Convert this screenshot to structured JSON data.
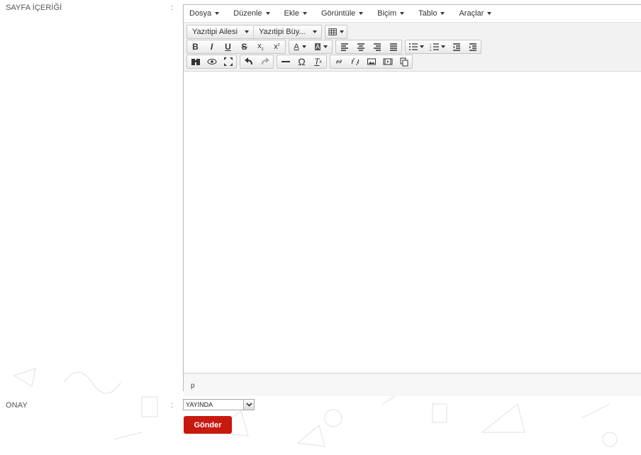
{
  "form": {
    "content_label": "SAYFA İÇERİĞİ",
    "approval_label": "ONAY",
    "colon": ":",
    "approval_value": "YAYINDA",
    "submit_label": "Gönder"
  },
  "editor": {
    "menus": [
      "Dosya",
      "Düzenle",
      "Ekle",
      "Görüntüle",
      "Biçim",
      "Tablo",
      "Araçlar"
    ],
    "font_family_label": "Yazıtipi Ailesi",
    "font_size_label": "Yazıtipi Büy...",
    "status_path": "p"
  },
  "colors": {
    "submit_bg": "#c8190f",
    "toolbar_bg": "#f2f2f2"
  }
}
